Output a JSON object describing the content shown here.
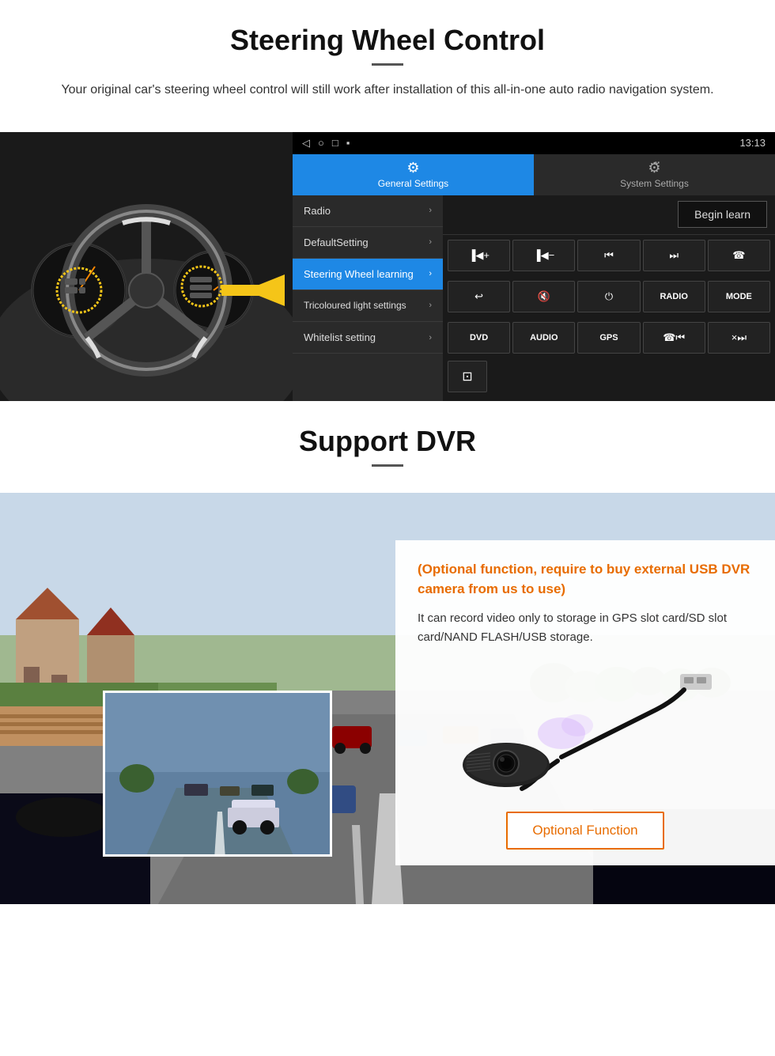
{
  "steering": {
    "title": "Steering Wheel Control",
    "description": "Your original car's steering wheel control will still work after installation of this all-in-one auto radio navigation system.",
    "statusbar": {
      "time": "13:13",
      "left_icons": [
        "◁",
        "○",
        "□",
        "▪"
      ]
    },
    "tabs": {
      "general": "General Settings",
      "system": "System Settings"
    },
    "menu_items": [
      {
        "label": "Radio",
        "active": false
      },
      {
        "label": "DefaultSetting",
        "active": false
      },
      {
        "label": "Steering Wheel learning",
        "active": true
      },
      {
        "label": "Tricoloured light settings",
        "active": false
      },
      {
        "label": "Whitelist setting",
        "active": false
      }
    ],
    "begin_learn": "Begin learn",
    "control_buttons_row1": [
      "▐◀+",
      "▐◀−",
      "◀◀",
      "▶▶",
      "☎"
    ],
    "control_buttons_row2": [
      "↩",
      "🔇×",
      "⏻",
      "RADIO",
      "MODE"
    ],
    "control_buttons_row3": [
      "DVD",
      "AUDIO",
      "GPS",
      "☎◀◀",
      "×▶▶"
    ],
    "misc_button": "⊡"
  },
  "dvr": {
    "title": "Support DVR",
    "optional_note": "(Optional function, require to buy external USB DVR camera from us to use)",
    "description": "It can record video only to storage in GPS slot card/SD slot card/NAND FLASH/USB storage.",
    "optional_function_label": "Optional Function"
  }
}
